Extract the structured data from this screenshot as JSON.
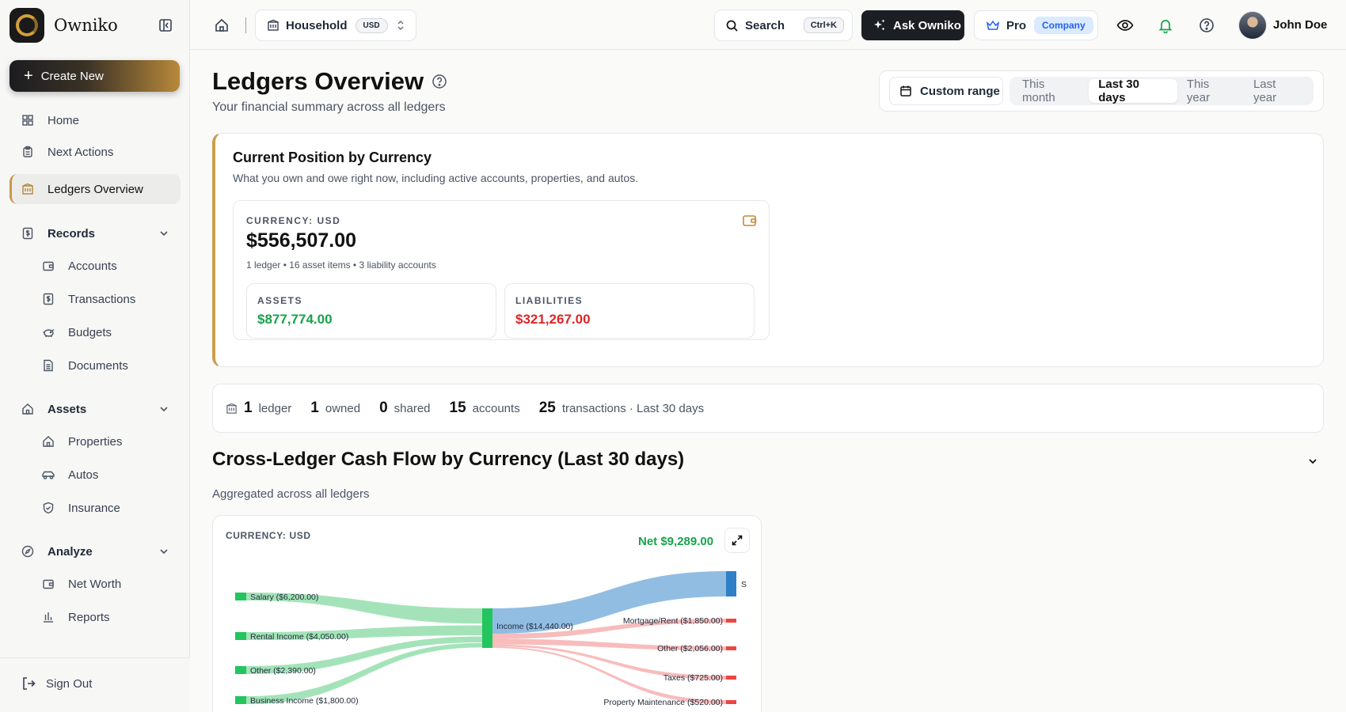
{
  "app": {
    "name": "Owniko"
  },
  "sidebar": {
    "create_label": "Create New",
    "items": [
      {
        "label": "Home",
        "icon": "grid-icon"
      },
      {
        "label": "Next Actions",
        "icon": "clipboard-icon"
      },
      {
        "label": "Ledgers Overview",
        "icon": "building-icon",
        "active": true
      }
    ],
    "sections": [
      {
        "label": "Records",
        "children": [
          {
            "label": "Accounts"
          },
          {
            "label": "Transactions"
          },
          {
            "label": "Budgets"
          },
          {
            "label": "Documents"
          }
        ]
      },
      {
        "label": "Assets",
        "children": [
          {
            "label": "Properties"
          },
          {
            "label": "Autos"
          },
          {
            "label": "Insurance"
          }
        ]
      },
      {
        "label": "Analyze",
        "children": [
          {
            "label": "Net Worth"
          },
          {
            "label": "Reports"
          }
        ]
      }
    ],
    "signout_label": "Sign Out"
  },
  "topbar": {
    "household": "Household",
    "currency": "USD",
    "search_label": "Search",
    "search_shortcut": "Ctrl+K",
    "ask_label": "Ask Owniko",
    "plan_label": "Pro",
    "plan_badge": "Company",
    "user_name": "John Doe"
  },
  "page": {
    "title": "Ledgers Overview",
    "subtitle": "Your financial summary across all ledgers",
    "custom_range": "Custom range",
    "ranges": [
      {
        "label": "This month"
      },
      {
        "label": "Last 30 days",
        "selected": true
      },
      {
        "label": "This year"
      },
      {
        "label": "Last year"
      }
    ]
  },
  "position": {
    "title": "Current Position by Currency",
    "subtitle": "What you own and owe right now, including active accounts, properties, and autos.",
    "currency_label": "CURRENCY: USD",
    "net": "$556,507.00",
    "meta": "1 ledger • 16 asset items • 3 liability accounts",
    "assets_label": "ASSETS",
    "assets_value": "$877,774.00",
    "liabilities_label": "LIABILITIES",
    "liabilities_value": "$321,267.00",
    "colors": {
      "assets": "#16a34a",
      "liabilities": "#dc2626",
      "accent": "#c9a04a"
    }
  },
  "stats": [
    {
      "value": "1",
      "label": "ledger"
    },
    {
      "value": "1",
      "label": "owned"
    },
    {
      "value": "0",
      "label": "shared"
    },
    {
      "value": "15",
      "label": "accounts"
    },
    {
      "value": "25",
      "label": "transactions · Last 30 days"
    }
  ],
  "cashflow": {
    "title": "Cross-Ledger Cash Flow by Currency (Last 30 days)",
    "subtitle": "Aggregated across all ledgers",
    "currency_label": "CURRENCY: USD",
    "net": "Net $9,289.00"
  },
  "chart_data": {
    "type": "sankey",
    "currency": "USD",
    "income_node": {
      "name": "Income",
      "value": 14440,
      "label": "Income ($14,440.00)"
    },
    "sources": [
      {
        "name": "Salary",
        "value": 6200,
        "label": "Salary ($6,200.00)"
      },
      {
        "name": "Rental Income",
        "value": 4050,
        "label": "Rental Income ($4,050.00)"
      },
      {
        "name": "Other",
        "value": 2390,
        "label": "Other ($2,390.00)"
      },
      {
        "name": "Business Income",
        "value": 1800,
        "label": "Business Income ($1,800.00)"
      }
    ],
    "targets": [
      {
        "name": "S",
        "value": 9289,
        "label": "S",
        "kind": "savings"
      },
      {
        "name": "Mortgage/Rent",
        "value": 1850,
        "label": "Mortgage/Rent ($1,850.00)",
        "kind": "expense"
      },
      {
        "name": "Other",
        "value": 2056,
        "label": "Other ($2,056.00)",
        "kind": "expense"
      },
      {
        "name": "Taxes",
        "value": 725,
        "label": "Taxes ($725.00)",
        "kind": "expense"
      },
      {
        "name": "Property Maintenance",
        "value": 520,
        "label": "Property Maintenance ($520.00)",
        "kind": "expense"
      }
    ],
    "colors": {
      "income": "#22c55e",
      "income_link": "#86d9a1",
      "savings": "#2f80c7",
      "savings_link": "#6ea7d9",
      "expense": "#ef4444",
      "expense_link": "#f6a5a5"
    }
  }
}
